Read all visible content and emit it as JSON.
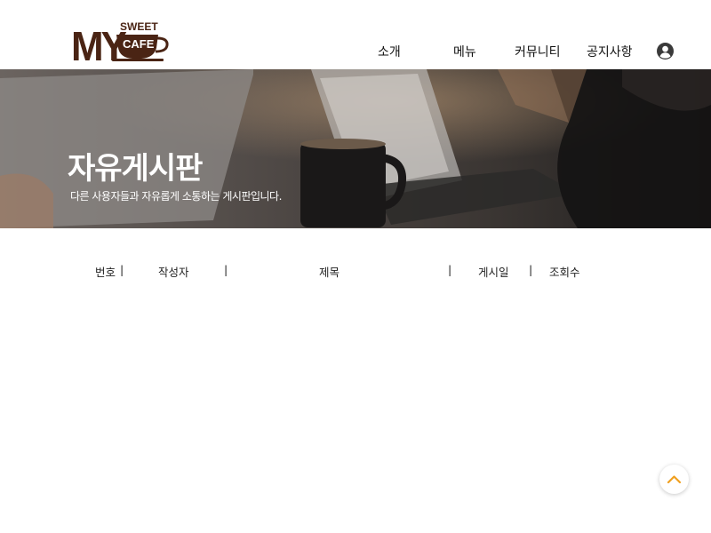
{
  "logo": {
    "main": "MY",
    "top": "SWEET",
    "cup": "CAFE"
  },
  "nav": {
    "items": [
      "소개",
      "메뉴",
      "커뮤니티",
      "공지사항"
    ]
  },
  "icons": {
    "account": "user-circle-icon",
    "scroll_top": "chevron-up-icon"
  },
  "hero": {
    "title": "자유게시판",
    "subtitle": "다른 사용자들과 자유롭게 소통하는 게시판입니다."
  },
  "board": {
    "columns": [
      "번호",
      "작성자",
      "제목",
      "게시일",
      "조회수"
    ],
    "separator": "|",
    "rows": []
  },
  "colors": {
    "brand": "#4a2414",
    "scroll_top_arrow": "#f0a020",
    "text": "#222222"
  }
}
